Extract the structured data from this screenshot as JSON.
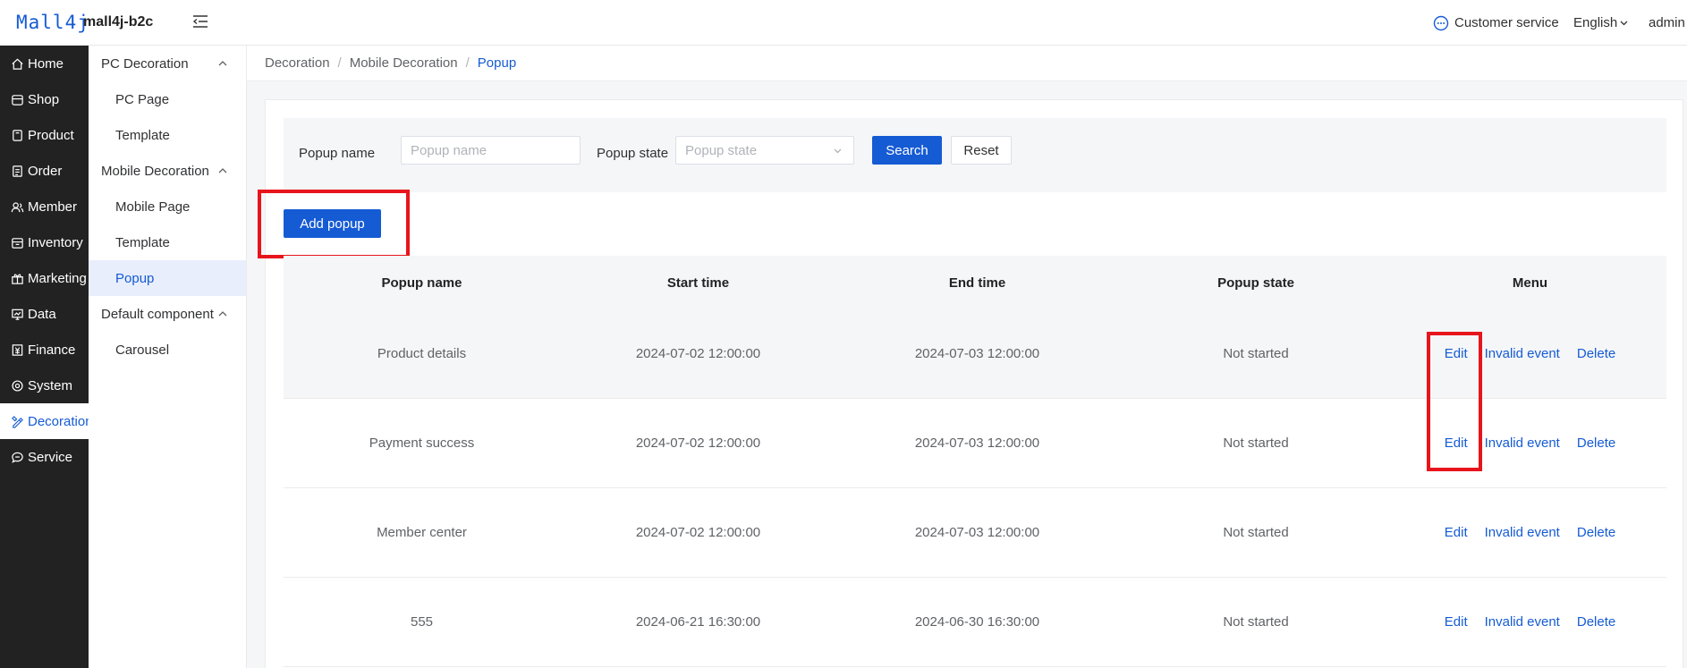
{
  "header": {
    "logo_text": "Mall4j",
    "shop_name": "mall4j-b2c",
    "customer_service": "Customer service",
    "language": "English",
    "user": "admin"
  },
  "sidebar": {
    "items": [
      {
        "label": "Home",
        "icon": "home-icon"
      },
      {
        "label": "Shop",
        "icon": "shop-icon"
      },
      {
        "label": "Product",
        "icon": "product-icon"
      },
      {
        "label": "Order",
        "icon": "order-icon"
      },
      {
        "label": "Member",
        "icon": "member-icon"
      },
      {
        "label": "Inventory",
        "icon": "inventory-icon"
      },
      {
        "label": "Marketing",
        "icon": "gift-icon"
      },
      {
        "label": "Data",
        "icon": "chart-icon"
      },
      {
        "label": "Finance",
        "icon": "finance-icon"
      },
      {
        "label": "System",
        "icon": "gear-icon"
      },
      {
        "label": "Decoration",
        "icon": "brush-icon",
        "active": true
      },
      {
        "label": "Service",
        "icon": "chat-icon"
      }
    ]
  },
  "submenu": {
    "groups": [
      {
        "label": "PC Decoration",
        "items": [
          "PC Page",
          "Template"
        ]
      },
      {
        "label": "Mobile Decoration",
        "items": [
          "Mobile Page",
          "Template",
          "Popup"
        ]
      },
      {
        "label": "Default component",
        "items": [
          "Carousel"
        ]
      }
    ],
    "active": "Popup"
  },
  "breadcrumb": [
    "Decoration",
    "Mobile Decoration",
    "Popup"
  ],
  "filter": {
    "name_label": "Popup name",
    "name_placeholder": "Popup name",
    "state_label": "Popup state",
    "state_placeholder": "Popup state",
    "search_label": "Search",
    "reset_label": "Reset"
  },
  "add_label": "Add popup",
  "table": {
    "columns": [
      "Popup name",
      "Start time",
      "End time",
      "Popup state",
      "Menu"
    ],
    "actions": [
      "Edit",
      "Invalid event",
      "Delete"
    ],
    "rows": [
      {
        "name": "Product details",
        "start": "2024-07-02 12:00:00",
        "end": "2024-07-03 12:00:00",
        "state": "Not started"
      },
      {
        "name": "Payment success",
        "start": "2024-07-02 12:00:00",
        "end": "2024-07-03 12:00:00",
        "state": "Not started"
      },
      {
        "name": "Member center",
        "start": "2024-07-02 12:00:00",
        "end": "2024-07-03 12:00:00",
        "state": "Not started"
      },
      {
        "name": "555",
        "start": "2024-06-21 16:30:00",
        "end": "2024-06-30 16:30:00",
        "state": "Not started"
      }
    ]
  },
  "colors": {
    "primary": "#155bd4",
    "sidebar_bg": "#222222",
    "highlight": "#e8141c"
  }
}
